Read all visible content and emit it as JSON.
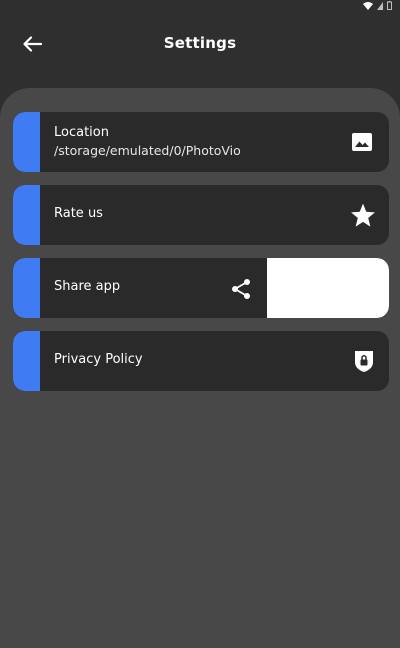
{
  "status_bar": {
    "icons": [
      "wifi-icon",
      "signal-icon",
      "battery-icon"
    ]
  },
  "header": {
    "title": "Settings",
    "back_icon": "arrow-left-icon"
  },
  "settings": {
    "items": [
      {
        "label": "Location",
        "subtitle": "/storage/emulated/0/PhotoVio",
        "icon": "image-icon"
      },
      {
        "label": "Rate us",
        "icon": "star-icon"
      },
      {
        "label": "Share app",
        "icon": "share-icon"
      },
      {
        "label": "Privacy Policy",
        "icon": "shield-lock-icon"
      }
    ]
  },
  "colors": {
    "background": "#2f2f2f",
    "panel": "#484848",
    "card": "#2a2a2a",
    "accent": "#3f7cf4",
    "text": "#ffffff"
  }
}
